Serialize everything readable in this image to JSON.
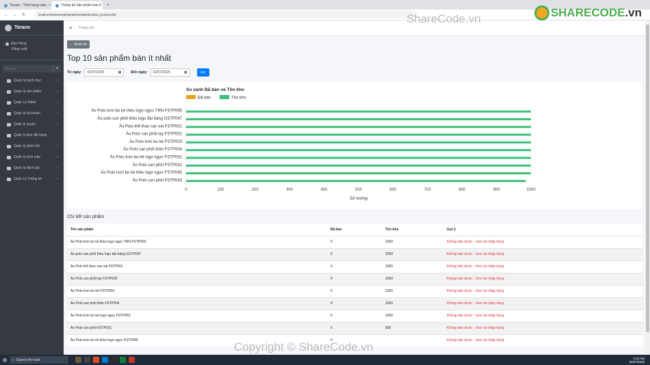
{
  "browser": {
    "tabs": [
      {
        "label": "Torano - Thời trang nam"
      },
      {
        "label": "Thống kê Sản phẩm bán ít"
      }
    ],
    "url": "localhost/doantotnghiep/admin/statistics/low_product.php"
  },
  "sidebar": {
    "brand": "Torano",
    "user_name": "Đào Hùng",
    "logout": "Đăng xuất",
    "search_placeholder": "Search",
    "items": [
      {
        "label": "Quản lý danh mục"
      },
      {
        "label": "Quản lý sản phẩm"
      },
      {
        "label": "Quản Lý Slider"
      },
      {
        "label": "Quản lý tài khoản"
      },
      {
        "label": "Quản lý quyền"
      },
      {
        "label": "Quản lý đơn đặt hàng"
      },
      {
        "label": "Quản lý phản hồi"
      },
      {
        "label": "Quản lý bình luận"
      },
      {
        "label": "Quản lý đánh giá"
      },
      {
        "label": "Quản Lý Thống kê"
      }
    ]
  },
  "topnav": {
    "home": "Trang chủ"
  },
  "page": {
    "back": "← Quay lại",
    "title": "Top 10 sản phẩm bán ít nhất",
    "from_label": "Từ ngày:",
    "from_value": "01/07/2025",
    "to_label": "Đến ngày:",
    "to_value": "02/07/2025",
    "filter_btn": "Lọc"
  },
  "colors": {
    "sold": "#e6a21a",
    "stock": "#3dbf7a",
    "accent": "#007bff"
  },
  "chart_data": {
    "type": "bar",
    "orientation": "horizontal",
    "title": "So sánh Đã bán và Tồn kho",
    "xlabel": "Số lượng",
    "xlim": [
      0,
      1000
    ],
    "xticks": [
      0,
      100,
      200,
      300,
      400,
      500,
      600,
      700,
      800,
      900,
      1000
    ],
    "categories": [
      "Áo Polo trơn bo kẻ thêu logo ngực TRN FSTP055",
      "Áo polo can phối thêu logo đại bàng GSTP047",
      "Áo Polo thể thao can vai FSTP001",
      "Áo Polo can phối tay FSTP002",
      "Áo Polo trơn bo kẻ FSTP003",
      "Áo Polo can phối thân FSTP004",
      "Áo Polo trơn bo kẻ logo ngực FSTP052",
      "Áo Polo can phối FSTP031",
      "Áo Polo trơn bo kẻ thêu logo ngực FSTP045",
      "Áo Polo can phối FSTP043"
    ],
    "series": [
      {
        "name": "Đã bán",
        "values": [
          0,
          0,
          0,
          0,
          0,
          0,
          0,
          0,
          0,
          0
        ]
      },
      {
        "name": "Tồn kho",
        "values": [
          1000,
          1000,
          1000,
          1000,
          1000,
          1000,
          1000,
          1000,
          1000,
          985
        ]
      }
    ],
    "legend": "top-left"
  },
  "table": {
    "section_title": "Chi tiết sản phẩm",
    "headers": [
      "Tên sản phẩm",
      "Đã bán",
      "Tồn kho",
      "Gợi ý"
    ],
    "rows": [
      [
        "Áo Polo trơn bo kẻ thêu logo ngực TRN FSTP055",
        "0",
        "1000",
        "Không bán được - Xem lại nhập hàng"
      ],
      [
        "Áo polo can phối thêu logo đại bàng GSTP047",
        "0",
        "1000",
        "Không bán được - Xem lại nhập hàng"
      ],
      [
        "Áo Polo thể thao can vai FSTP001",
        "0",
        "1000",
        "Không bán được - Xem lại nhập hàng"
      ],
      [
        "Áo Polo can phối tay FSTP002",
        "0",
        "1000",
        "Không bán được - Xem lại nhập hàng"
      ],
      [
        "Áo Polo trơn bo kẻ FSTP003",
        "0",
        "1000",
        "Không bán được - Xem lại nhập hàng"
      ],
      [
        "Áo Polo can phối thân FSTP004",
        "0",
        "1000",
        "Không bán được - Xem lại nhập hàng"
      ],
      [
        "Áo Polo trơn bo kẻ logo ngực FSTP052",
        "0",
        "1000",
        "Không bán được - Xem lại nhập hàng"
      ],
      [
        "Áo Polo can phối FSTP031",
        "0",
        "999",
        "Không bán được - Xem lại nhập hàng"
      ],
      [
        "Áo Polo trơn bo kẻ thêu logo ngực FSTP045",
        "0",
        "",
        "Không bán được - Xem lại nhập hàng"
      ]
    ]
  },
  "taskbar": {
    "search": "Search the web",
    "time": "1:02 AM",
    "date": "02/07/2025"
  },
  "watermark": {
    "brand": "SHARECODE",
    "tld": ".vn",
    "text1": "ShareCode.vn",
    "text2": "Copyright © ShareCode.vn"
  }
}
